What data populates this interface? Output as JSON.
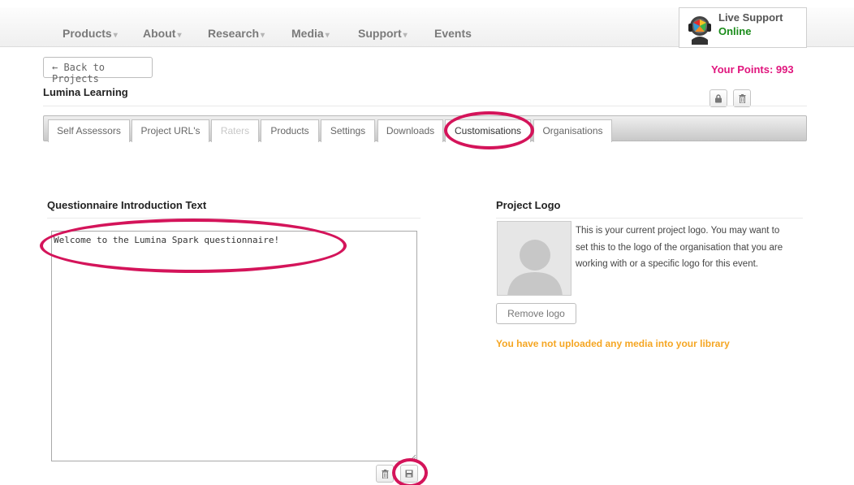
{
  "nav": {
    "items": [
      {
        "label": "Products",
        "caret": "▾"
      },
      {
        "label": "About",
        "caret": "▾"
      },
      {
        "label": "Research",
        "caret": "▾"
      },
      {
        "label": "Media",
        "caret": "▾"
      },
      {
        "label": "Support",
        "caret": "▾"
      },
      {
        "label": "Events",
        "caret": ""
      }
    ],
    "live_support": {
      "title": "Live Support",
      "status": "Online",
      "icon": "live-support-headset-icon"
    }
  },
  "header": {
    "back_label": "← Back to Projects",
    "points": "Your Points: 993",
    "project_title": "Lumina Learning",
    "lock_icon": "lock-icon",
    "delete_icon": "trash-icon"
  },
  "tabs": [
    {
      "label": "Self Assessors",
      "state": "normal"
    },
    {
      "label": "Project URL's",
      "state": "normal"
    },
    {
      "label": "Raters",
      "state": "disabled"
    },
    {
      "label": "Products",
      "state": "normal"
    },
    {
      "label": "Settings",
      "state": "normal"
    },
    {
      "label": "Downloads",
      "state": "normal"
    },
    {
      "label": "Customisations",
      "state": "active"
    },
    {
      "label": "Organisations",
      "state": "normal"
    }
  ],
  "intro": {
    "title": "Questionnaire Introduction Text",
    "text": "Welcome to the Lumina Spark questionnaire!",
    "delete_icon": "trash-icon",
    "save_icon": "save-icon"
  },
  "logo": {
    "title": "Project Logo",
    "description": "This is your current project logo. You may want to set this to the logo of the organisation that you are working with or a specific logo for this event.",
    "remove_label": "Remove logo",
    "no_media": "You have not uploaded any media into your library",
    "placeholder_icon": "default-avatar-icon"
  },
  "colors": {
    "points": "#e0157d",
    "online": "#1a8c1a",
    "warning": "#f5a623",
    "highlight": "#d4145a"
  }
}
